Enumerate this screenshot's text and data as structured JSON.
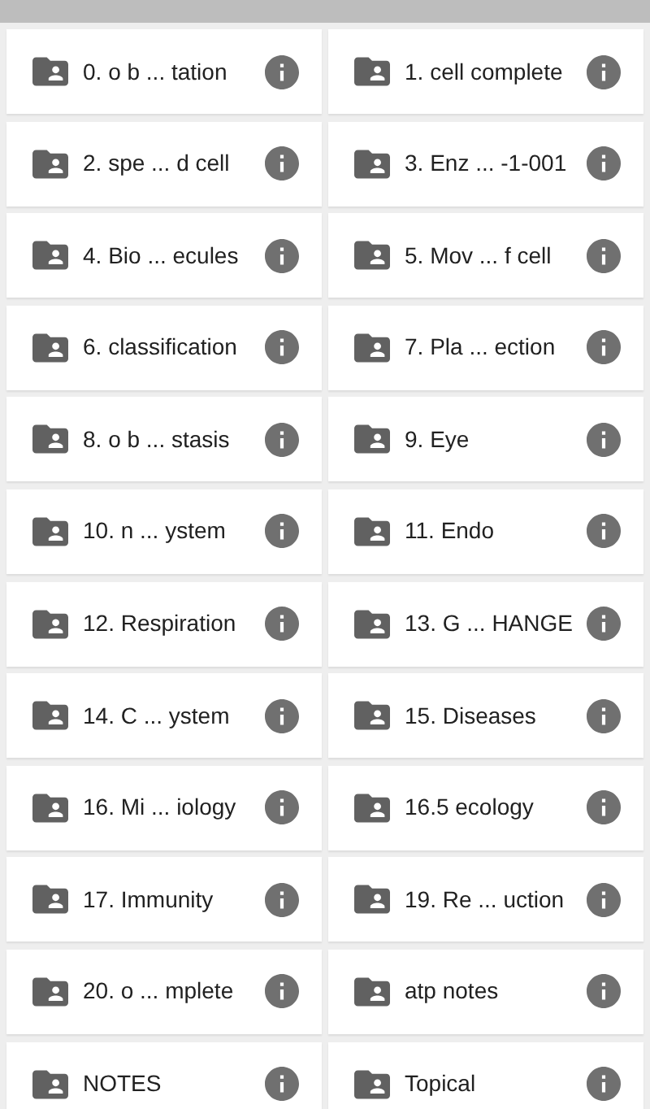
{
  "folders": [
    {
      "name": "0. o b ... tation"
    },
    {
      "name": "1. cell complete"
    },
    {
      "name": "2. spe ... d cell"
    },
    {
      "name": "3. Enz ... -1-001"
    },
    {
      "name": "4. Bio ... ecules"
    },
    {
      "name": "5. Mov ... f cell"
    },
    {
      "name": "6. classification"
    },
    {
      "name": "7. Pla ... ection"
    },
    {
      "name": "8. o b ... stasis"
    },
    {
      "name": "9. Eye"
    },
    {
      "name": "10. n ... ystem"
    },
    {
      "name": "11. Endo"
    },
    {
      "name": "12. Respiration"
    },
    {
      "name": "13. G ... HANGE"
    },
    {
      "name": "14. C ... ystem"
    },
    {
      "name": "15. Diseases"
    },
    {
      "name": "16. Mi ... iology"
    },
    {
      "name": "16.5 ecology"
    },
    {
      "name": "17. Immunity"
    },
    {
      "name": "19. Re ... uction"
    },
    {
      "name": "20. o ... mplete"
    },
    {
      "name": "atp notes"
    },
    {
      "name": "NOTES"
    },
    {
      "name": "Topical"
    }
  ]
}
